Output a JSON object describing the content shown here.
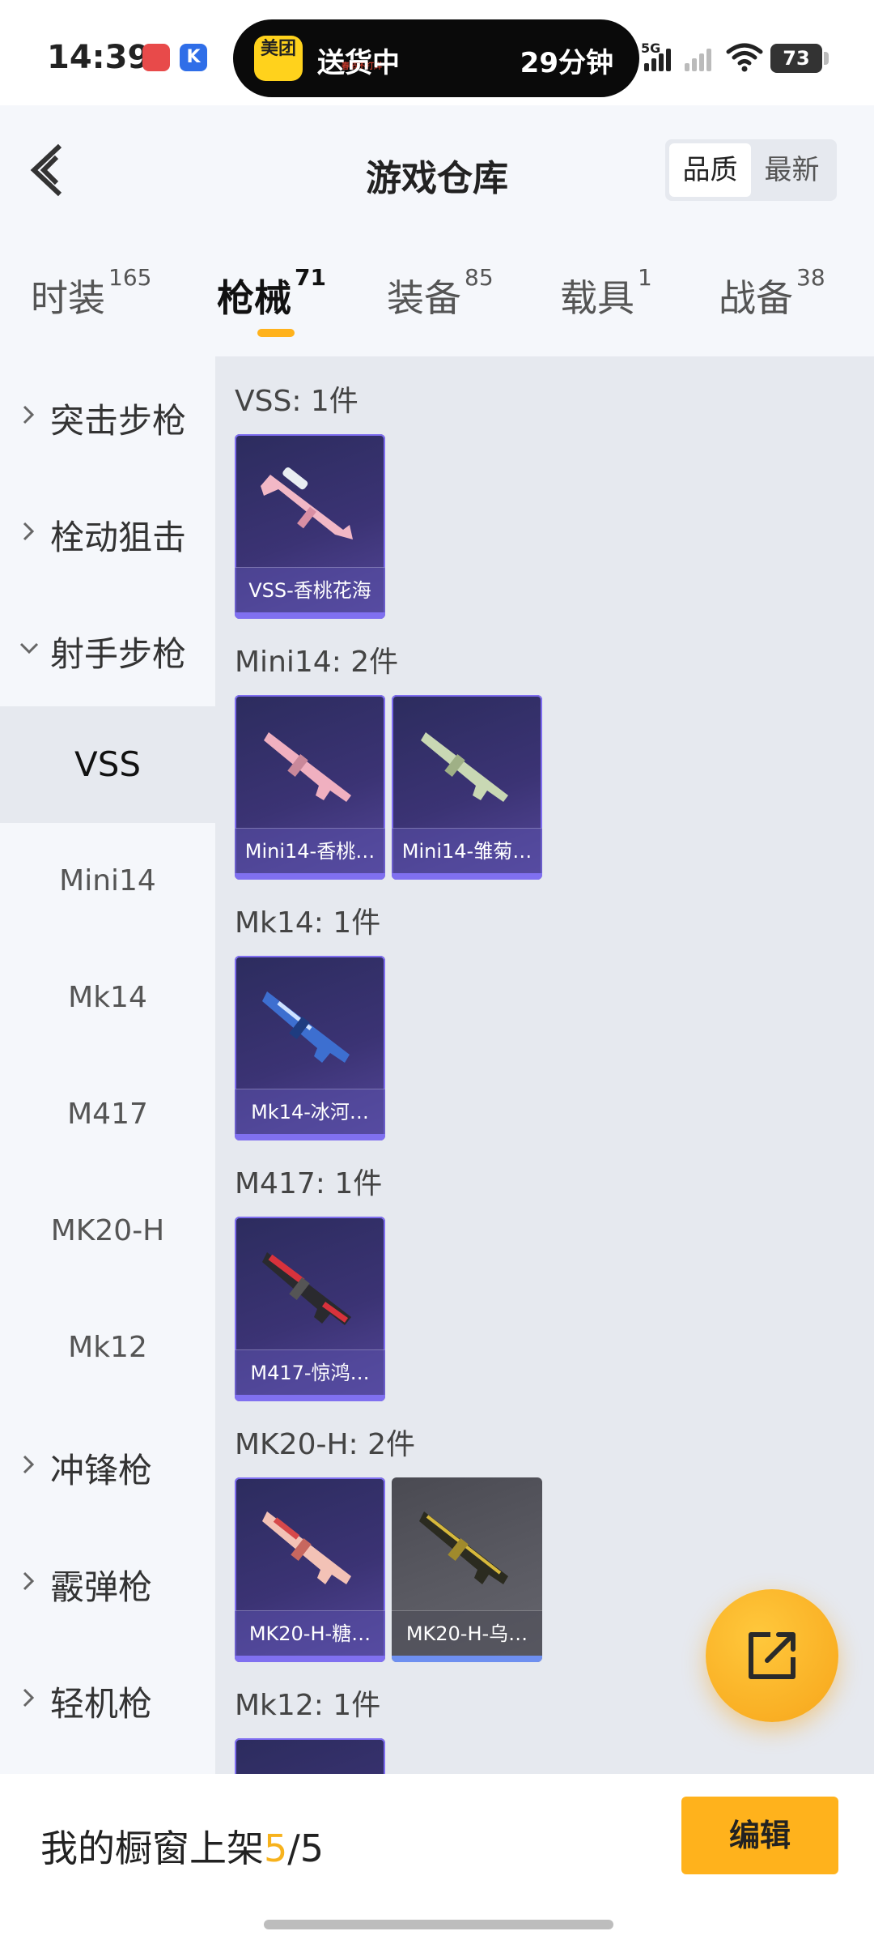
{
  "status_bar": {
    "time": "14:39",
    "island_logo": "美团",
    "island_logo_sub": "春节不打烊",
    "island_status": "送货中",
    "island_eta": "29分钟",
    "network": "5G",
    "battery": "73"
  },
  "header": {
    "title": "游戏仓库",
    "sort_options": [
      "品质",
      "最新"
    ],
    "active_sort": "品质"
  },
  "tabs": [
    {
      "label": "时装",
      "count": "165"
    },
    {
      "label": "枪械",
      "count": "71",
      "active": true
    },
    {
      "label": "装备",
      "count": "85"
    },
    {
      "label": "载具",
      "count": "1"
    },
    {
      "label": "战备",
      "count": "38"
    }
  ],
  "sidebar": {
    "categories_top": [
      {
        "label": "突击步枪"
      },
      {
        "label": "栓动狙击"
      },
      {
        "label": "射手步枪",
        "expanded": true
      }
    ],
    "subitems": [
      {
        "label": "VSS",
        "active": true
      },
      {
        "label": "Mini14"
      },
      {
        "label": "Mk14"
      },
      {
        "label": "M417"
      },
      {
        "label": "MK20-H"
      },
      {
        "label": "Mk12"
      }
    ],
    "categories_bottom": [
      {
        "label": "冲锋枪"
      },
      {
        "label": "霰弹枪"
      },
      {
        "label": "轻机枪"
      }
    ]
  },
  "groups": [
    {
      "title": "VSS: 1件",
      "items": [
        {
          "name": "VSS-香桃花海"
        }
      ]
    },
    {
      "title": "Mini14: 2件",
      "items": [
        {
          "name": "Mini14-香桃…"
        },
        {
          "name": "Mini14-雏菊…"
        }
      ]
    },
    {
      "title": "Mk14: 1件",
      "items": [
        {
          "name": "Mk14-冰河…"
        }
      ]
    },
    {
      "title": "M417: 1件",
      "items": [
        {
          "name": "M417-惊鸿…"
        }
      ]
    },
    {
      "title": "MK20-H: 2件",
      "items": [
        {
          "name": "MK20-H-糖…"
        },
        {
          "name": "MK20-H-乌…"
        }
      ]
    },
    {
      "title": "Mk12: 1件",
      "items": []
    }
  ],
  "bottom_bar": {
    "showcase_label": "我的橱窗上架",
    "showcase_current": "5",
    "showcase_total": "/5",
    "edit_label": "编辑"
  },
  "colors": {
    "accent": "#ffb21c",
    "card_purple": "#3b3374",
    "card_gray": "#5a5a62"
  },
  "icons": {
    "back": "chevron-left-icon",
    "fab": "share-external-icon",
    "category_collapsed": "chevron-right-icon",
    "category_expanded": "chevron-down-icon"
  }
}
